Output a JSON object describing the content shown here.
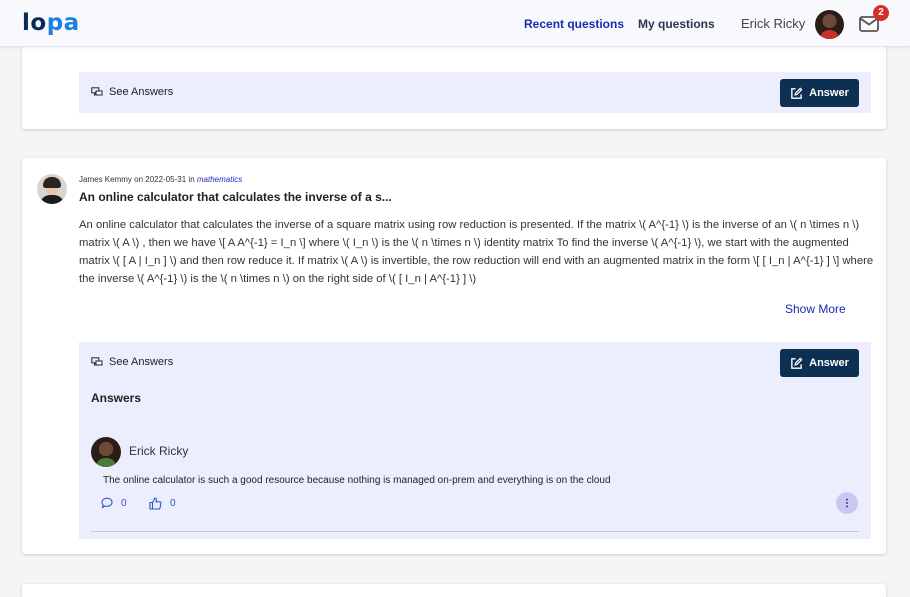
{
  "app": {
    "logo_part1": "lo",
    "logo_part2": "pa",
    "brand_colors": {
      "dark": "#0a2a5c",
      "accent": "#1e7fe0"
    }
  },
  "nav": {
    "recent_questions": "Recent questions",
    "my_questions": "My questions",
    "user_name": "Erick Ricky",
    "notification_count": "2"
  },
  "top_card": {
    "see_answers": "See Answers",
    "answer_button": "Answer"
  },
  "question": {
    "author": "James Kemmy",
    "date_prefix": "on 2022-05-31",
    "in_label": "in",
    "subject": "mathematics",
    "title": "An online calculator that calculates the inverse of a s...",
    "body": "An online calculator that calculates the inverse of a square matrix using row reduction is presented. If the matrix \\( A^{-1} \\) is the inverse of an \\( n \\times n \\) matrix \\( A \\) , then we have \\[ A A^{-1} = I_n \\] where \\( I_n \\) is the \\( n \\times n \\) identity matrix To find the inverse \\( A^{-1} \\), we start with the augmented matrix \\( [ A | I_n ] \\) and then row reduce it. If matrix \\( A \\) is invertible, the row reduction will end with an augmented matrix in the form \\[ [ I_n | A^{-1} ] \\] where the inverse \\( A^{-1} \\) is the \\( n \\times n \\) on the right side of \\( [ I_n | A^{-1} ] \\)",
    "show_more": "Show More",
    "see_answers": "See Answers",
    "answer_button": "Answer",
    "answers_heading": "Answers"
  },
  "answer": {
    "author": "Erick Ricky",
    "text": "The online calculator is such a good resource because nothing is managed on-prem and everything is on the cloud",
    "comment_count": "0",
    "like_count": "0"
  },
  "icons": [
    "mail-icon",
    "chat-icon",
    "edit-icon",
    "comment-icon",
    "thumbs-up-icon",
    "more-vertical-icon"
  ]
}
